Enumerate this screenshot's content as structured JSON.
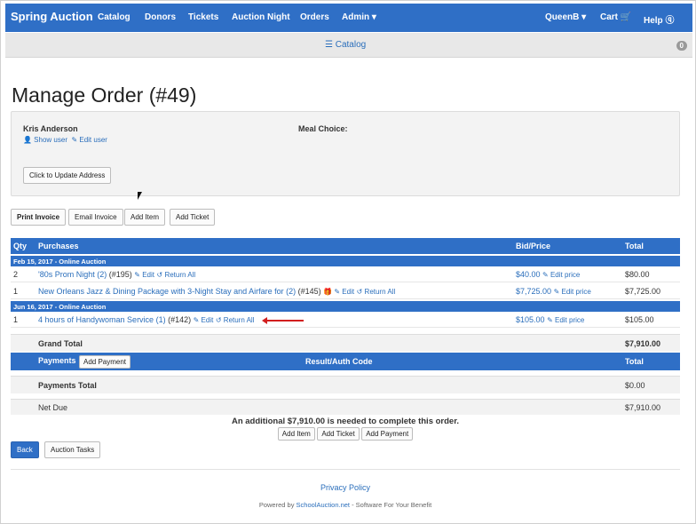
{
  "navbar": {
    "brand": "Spring Auction",
    "items": [
      "Catalog",
      "Donors",
      "Tickets",
      "Auction Night",
      "Orders",
      "Admin ▾"
    ],
    "right_items": [
      "QueenB ▾",
      "Cart 🛒",
      "Help ⓠ"
    ]
  },
  "subnav": {
    "catalog": "☰ Catalog",
    "badge": "0"
  },
  "page_title": "Manage Order (#49)",
  "customer": {
    "name": "Kris Anderson",
    "meal_label": "Meal Choice:",
    "show_user": "👤 Show user",
    "edit_user": "✎ Edit user",
    "update_address": "Click to Update Address"
  },
  "actions": [
    "Print Invoice",
    "Email Invoice",
    "Add Item",
    "Add Ticket"
  ],
  "table": {
    "headers": {
      "qty": "Qty",
      "purchases": "Purchases",
      "bid": "Bid/Price",
      "total": "Total"
    },
    "groups": [
      {
        "label": "Feb 15, 2017 - Online Auction",
        "rows": [
          {
            "qty": "2",
            "item": "'80s Prom Night (2)",
            "ref": "(#195)",
            "edit": "✎ Edit",
            "return": "↺ Return All",
            "price": "$40.00",
            "edit_price": "✎ Edit price",
            "total": "$80.00"
          },
          {
            "qty": "1",
            "item": "New Orleans Jazz & Dining Package with 3-Night Stay and Airfare for (2)",
            "ref": "(#145)",
            "edit": "🎁 ✎ Edit",
            "return": "↺ Return All",
            "price": "$7,725.00",
            "edit_price": "✎ Edit price",
            "total": "$7,725.00"
          }
        ]
      },
      {
        "label": "Jun 16, 2017 - Online Auction",
        "rows": [
          {
            "qty": "1",
            "item": "4 hours of Handywoman Service (1)",
            "ref": "(#142)",
            "edit": "✎ Edit",
            "return": "↺ Return All",
            "price": "$105.00",
            "edit_price": "✎ Edit price",
            "total": "$105.00"
          }
        ]
      }
    ],
    "grand_total_label": "Grand Total",
    "grand_total": "$7,910.00"
  },
  "payments": {
    "header": "Payments",
    "add_payment": "Add Payment",
    "result_header": "Result/Auth Code",
    "total_header": "Total",
    "payments_total_label": "Payments Total",
    "payments_total": "$0.00",
    "net_due_label": "Net Due",
    "net_due": "$7,910.00"
  },
  "notice": "An additional $7,910.00 is needed to complete this order.",
  "notice_buttons": [
    "Add Item",
    "Add Ticket",
    "Add Payment"
  ],
  "bottom_buttons": [
    "Back",
    "Auction Tasks"
  ],
  "footer": {
    "privacy": "Privacy Policy",
    "powered_prefix": "Powered by ",
    "powered_link": "SchoolAuction.net",
    "powered_suffix": " - Software For Your Benefit"
  }
}
